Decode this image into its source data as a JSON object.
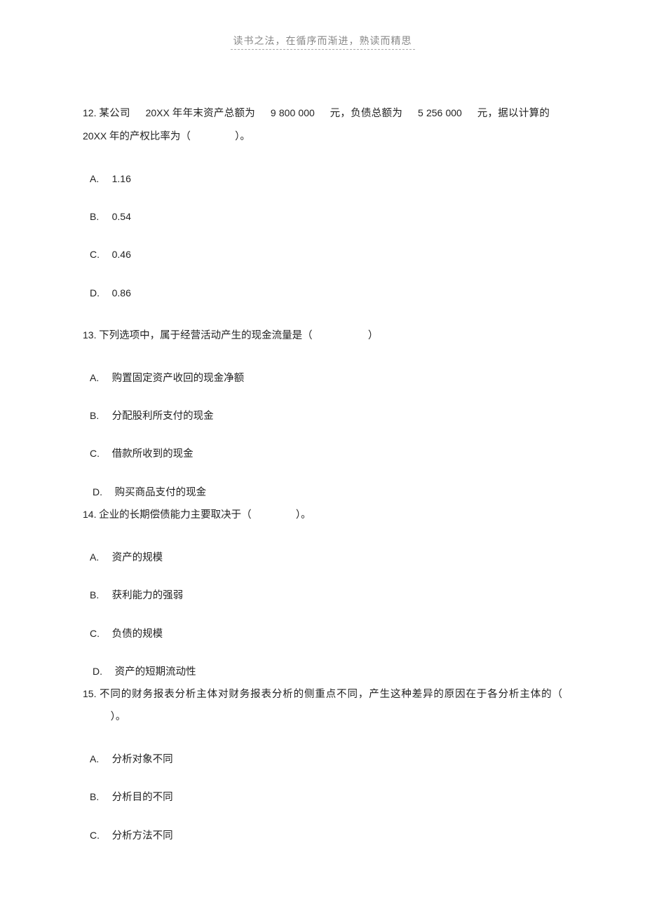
{
  "header": {
    "motto": "读书之法，在循序而渐进，熟读而精思"
  },
  "questions": [
    {
      "number": "12.",
      "stem_parts": {
        "p1": "某公司",
        "year1": "20XX",
        "p2": "年年末资产总额为",
        "amt1": "9 800 000",
        "p3": "元，负债总额为",
        "amt2": "5 256 000",
        "p4": "元，据以计算的",
        "year2": "20XX",
        "p5": "年的产权比率为（",
        "p6": "）。"
      },
      "options": [
        {
          "letter": "A.",
          "text": "1.16"
        },
        {
          "letter": "B.",
          "text": "0.54"
        },
        {
          "letter": "C.",
          "text": "0.46"
        },
        {
          "letter": "D.",
          "text": "0.86"
        }
      ]
    },
    {
      "number": "13.",
      "stem_parts": {
        "p1": "下列选项中，属于经营活动产生的现金流量是（",
        "p2": "）"
      },
      "options": [
        {
          "letter": "A.",
          "text": "购置固定资产收回的现金净额"
        },
        {
          "letter": "B.",
          "text": "分配股利所支付的现金"
        },
        {
          "letter": "C.",
          "text": "借款所收到的现金"
        },
        {
          "letter": "D.",
          "text": "购买商品支付的现金"
        }
      ]
    },
    {
      "number": "14.",
      "stem_parts": {
        "p1": "企业的长期偿债能力主要取决于（",
        "p2": "）。"
      },
      "options": [
        {
          "letter": "A.",
          "text": "资产的规模"
        },
        {
          "letter": "B.",
          "text": "获利能力的强弱"
        },
        {
          "letter": "C.",
          "text": "负债的规模"
        },
        {
          "letter": "D.",
          "text": "资产的短期流动性"
        }
      ]
    },
    {
      "number": "15.",
      "stem_parts": {
        "p1": "不同的财务报表分析主体对财务报表分析的侧重点不同，产生这种差异的原因在于各分析主体的（",
        "p2": "）。"
      },
      "options": [
        {
          "letter": "A.",
          "text": "分析对象不同"
        },
        {
          "letter": "B.",
          "text": "分析目的不同"
        },
        {
          "letter": "C.",
          "text": "分析方法不同"
        }
      ]
    }
  ]
}
